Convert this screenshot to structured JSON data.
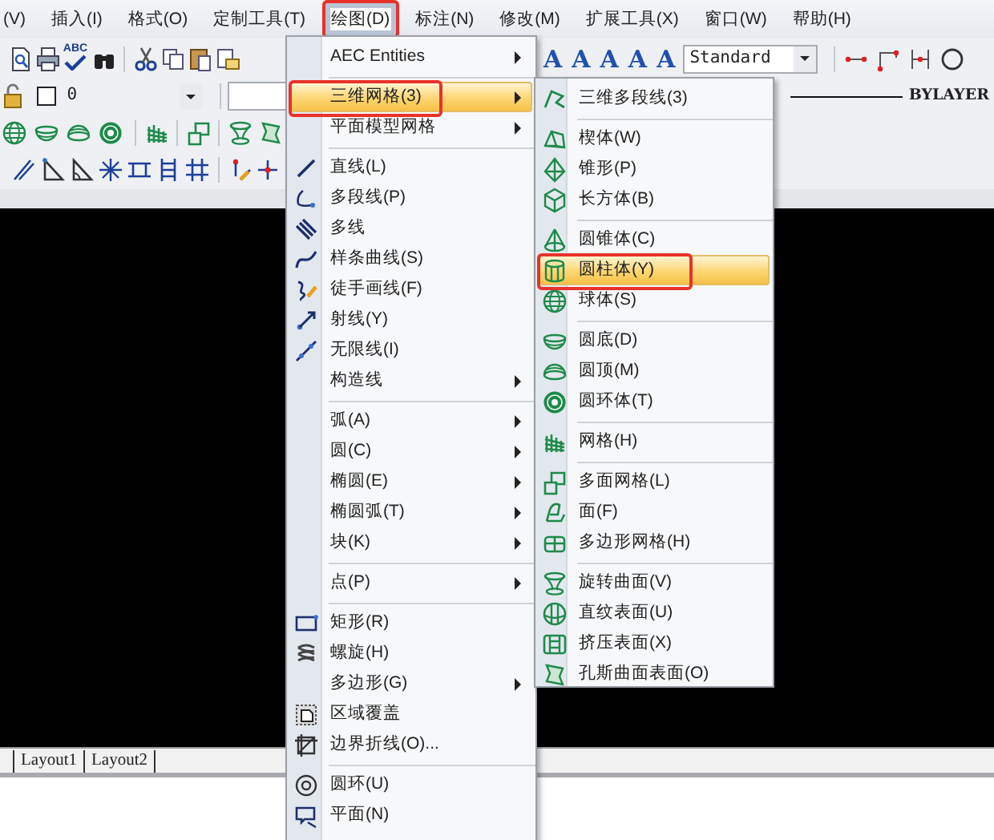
{
  "menubar": [
    {
      "label": "(V)",
      "selected": false,
      "annotated": false
    },
    {
      "label": "插入(I)",
      "selected": false,
      "annotated": false
    },
    {
      "label": "格式(O)",
      "selected": false,
      "annotated": false
    },
    {
      "label": "定制工具(T)",
      "selected": false,
      "annotated": false
    },
    {
      "label": "绘图(D)",
      "selected": true,
      "annotated": true
    },
    {
      "label": "标注(N)",
      "selected": false,
      "annotated": false
    },
    {
      "label": "修改(M)",
      "selected": false,
      "annotated": false
    },
    {
      "label": "扩展工具(X)",
      "selected": false,
      "annotated": false
    },
    {
      "label": "窗口(W)",
      "selected": false,
      "annotated": false
    },
    {
      "label": "帮助(H)",
      "selected": false,
      "annotated": false
    }
  ],
  "toolbar": {
    "spell_check": "ABC",
    "layer": {
      "value": "0"
    },
    "text_letters": [
      "A",
      "A",
      "A",
      "A",
      "A"
    ],
    "text_style": {
      "value": "Standard"
    },
    "lineweight": {
      "value": "BYLAYER"
    }
  },
  "draw_menu": {
    "items": [
      {
        "kind": "item",
        "label": "AEC Entities",
        "submenu": true,
        "selected": false,
        "annotated": false
      },
      {
        "kind": "separator"
      },
      {
        "kind": "item",
        "label": "三维网格(3)",
        "submenu": true,
        "selected": true,
        "annotated": true
      },
      {
        "kind": "item",
        "label": "平面模型网格",
        "submenu": true,
        "selected": false,
        "annotated": false
      },
      {
        "kind": "separator"
      },
      {
        "kind": "item",
        "label": "直线(L)",
        "submenu": false,
        "selected": false,
        "annotated": false
      },
      {
        "kind": "item",
        "label": "多段线(P)",
        "submenu": false,
        "selected": false,
        "annotated": false
      },
      {
        "kind": "item",
        "label": "多线",
        "submenu": false,
        "selected": false,
        "annotated": false
      },
      {
        "kind": "item",
        "label": "样条曲线(S)",
        "submenu": false,
        "selected": false,
        "annotated": false
      },
      {
        "kind": "item",
        "label": "徒手画线(F)",
        "submenu": false,
        "selected": false,
        "annotated": false
      },
      {
        "kind": "item",
        "label": "射线(Y)",
        "submenu": false,
        "selected": false,
        "annotated": false
      },
      {
        "kind": "item",
        "label": "无限线(I)",
        "submenu": false,
        "selected": false,
        "annotated": false
      },
      {
        "kind": "item",
        "label": "构造线",
        "submenu": true,
        "selected": false,
        "annotated": false
      },
      {
        "kind": "separator"
      },
      {
        "kind": "item",
        "label": "弧(A)",
        "submenu": true,
        "selected": false,
        "annotated": false
      },
      {
        "kind": "item",
        "label": "圆(C)",
        "submenu": true,
        "selected": false,
        "annotated": false
      },
      {
        "kind": "item",
        "label": "椭圆(E)",
        "submenu": true,
        "selected": false,
        "annotated": false
      },
      {
        "kind": "item",
        "label": "椭圆弧(T)",
        "submenu": true,
        "selected": false,
        "annotated": false
      },
      {
        "kind": "item",
        "label": "块(K)",
        "submenu": true,
        "selected": false,
        "annotated": false
      },
      {
        "kind": "separator"
      },
      {
        "kind": "item",
        "label": "点(P)",
        "submenu": true,
        "selected": false,
        "annotated": false
      },
      {
        "kind": "separator"
      },
      {
        "kind": "item",
        "label": "矩形(R)",
        "submenu": false,
        "selected": false,
        "annotated": false
      },
      {
        "kind": "item",
        "label": "螺旋(H)",
        "submenu": false,
        "selected": false,
        "annotated": false
      },
      {
        "kind": "item",
        "label": "多边形(G)",
        "submenu": true,
        "selected": false,
        "annotated": false
      },
      {
        "kind": "item",
        "label": "区域覆盖",
        "submenu": false,
        "selected": false,
        "annotated": false
      },
      {
        "kind": "item",
        "label": "边界折线(O)...",
        "submenu": false,
        "selected": false,
        "annotated": false
      },
      {
        "kind": "separator"
      },
      {
        "kind": "item",
        "label": "圆环(U)",
        "submenu": false,
        "selected": false,
        "annotated": false
      },
      {
        "kind": "item",
        "label": "平面(N)",
        "submenu": false,
        "selected": false,
        "annotated": false
      }
    ]
  },
  "mesh_submenu": {
    "items": [
      {
        "kind": "item",
        "label": "三维多段线(3)",
        "submenu": false,
        "selected": false,
        "annotated": false
      },
      {
        "kind": "separator"
      },
      {
        "kind": "item",
        "label": "楔体(W)",
        "submenu": false,
        "selected": false,
        "annotated": false
      },
      {
        "kind": "item",
        "label": "锥形(P)",
        "submenu": false,
        "selected": false,
        "annotated": false
      },
      {
        "kind": "item",
        "label": "长方体(B)",
        "submenu": false,
        "selected": false,
        "annotated": false
      },
      {
        "kind": "separator"
      },
      {
        "kind": "item",
        "label": "圆锥体(C)",
        "submenu": false,
        "selected": false,
        "annotated": false
      },
      {
        "kind": "item",
        "label": "圆柱体(Y)",
        "submenu": false,
        "selected": true,
        "annotated": true
      },
      {
        "kind": "item",
        "label": "球体(S)",
        "submenu": false,
        "selected": false,
        "annotated": false
      },
      {
        "kind": "separator"
      },
      {
        "kind": "item",
        "label": "圆底(D)",
        "submenu": false,
        "selected": false,
        "annotated": false
      },
      {
        "kind": "item",
        "label": "圆顶(M)",
        "submenu": false,
        "selected": false,
        "annotated": false
      },
      {
        "kind": "item",
        "label": "圆环体(T)",
        "submenu": false,
        "selected": false,
        "annotated": false
      },
      {
        "kind": "separator"
      },
      {
        "kind": "item",
        "label": "网格(H)",
        "submenu": false,
        "selected": false,
        "annotated": false
      },
      {
        "kind": "separator"
      },
      {
        "kind": "item",
        "label": "多面网格(L)",
        "submenu": false,
        "selected": false,
        "annotated": false
      },
      {
        "kind": "item",
        "label": "面(F)",
        "submenu": false,
        "selected": false,
        "annotated": false
      },
      {
        "kind": "item",
        "label": "多边形网格(H)",
        "submenu": false,
        "selected": false,
        "annotated": false
      },
      {
        "kind": "separator"
      },
      {
        "kind": "item",
        "label": "旋转曲面(V)",
        "submenu": false,
        "selected": false,
        "annotated": false
      },
      {
        "kind": "item",
        "label": "直纹表面(U)",
        "submenu": false,
        "selected": false,
        "annotated": false
      },
      {
        "kind": "item",
        "label": "挤压表面(X)",
        "submenu": false,
        "selected": false,
        "annotated": false
      },
      {
        "kind": "item",
        "label": "孔斯曲面表面(O)",
        "submenu": false,
        "selected": false,
        "annotated": false
      }
    ]
  },
  "layout_tabs": [
    {
      "label": "Layout1"
    },
    {
      "label": "Layout2"
    }
  ]
}
